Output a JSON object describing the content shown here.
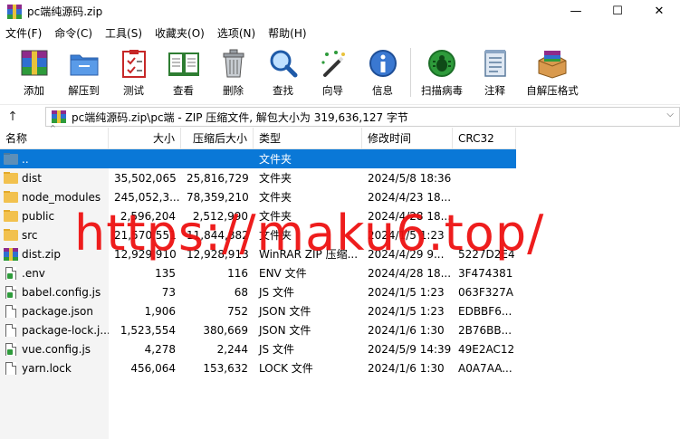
{
  "window": {
    "title": "pc端纯源码.zip",
    "controls": {
      "minimize": "—",
      "maximize": "☐",
      "close": "✕"
    }
  },
  "menu": [
    "文件(F)",
    "命令(C)",
    "工具(S)",
    "收藏夹(O)",
    "选项(N)",
    "帮助(H)"
  ],
  "toolbar": [
    {
      "id": "add",
      "label": "添加",
      "icon": "archive-add-icon"
    },
    {
      "id": "extract",
      "label": "解压到",
      "icon": "folder-extract-icon"
    },
    {
      "id": "test",
      "label": "测试",
      "icon": "clipboard-check-icon"
    },
    {
      "id": "view",
      "label": "查看",
      "icon": "book-icon"
    },
    {
      "id": "delete",
      "label": "删除",
      "icon": "trash-icon"
    },
    {
      "id": "find",
      "label": "查找",
      "icon": "magnifier-icon"
    },
    {
      "id": "wizard",
      "label": "向导",
      "icon": "magic-wand-icon"
    },
    {
      "id": "info",
      "label": "信息",
      "icon": "info-icon"
    },
    {
      "id": "virus",
      "label": "扫描病毒",
      "icon": "bug-scan-icon"
    },
    {
      "id": "comment",
      "label": "注释",
      "icon": "notepad-icon"
    },
    {
      "id": "sfx",
      "label": "自解压格式",
      "icon": "sfx-box-icon"
    }
  ],
  "address": {
    "up_icon": "↑",
    "path": "pc端纯源码.zip\\pc端 - ZIP 压缩文件, 解包大小为 319,636,127 字节",
    "dropdown_icon": "chevron-down-icon"
  },
  "columns": {
    "name": "名称",
    "size": "大小",
    "packed": "压缩后大小",
    "type": "类型",
    "modified": "修改时间",
    "crc": "CRC32",
    "sort_arrow": "^"
  },
  "rows": [
    {
      "icon": "folder-up",
      "name": "..",
      "size": "",
      "packed": "",
      "type": "文件夹",
      "modified": "",
      "crc": "",
      "selected": true
    },
    {
      "icon": "folder",
      "name": "dist",
      "size": "35,502,065",
      "packed": "25,816,729",
      "type": "文件夹",
      "modified": "2024/5/8 18:36",
      "crc": ""
    },
    {
      "icon": "folder",
      "name": "node_modules",
      "size": "245,052,3...",
      "packed": "78,359,210",
      "type": "文件夹",
      "modified": "2024/4/23 18...",
      "crc": ""
    },
    {
      "icon": "folder",
      "name": "public",
      "size": "2,596,204",
      "packed": "2,512,990",
      "type": "文件夹",
      "modified": "2024/4/28 18...",
      "crc": ""
    },
    {
      "icon": "folder",
      "name": "src",
      "size": "21,570,551",
      "packed": "11,844,882",
      "type": "文件夹",
      "modified": "2024/1/5 1:23",
      "crc": ""
    },
    {
      "icon": "rar",
      "name": "dist.zip",
      "size": "12,929,910",
      "packed": "12,928,913",
      "type": "WinRAR ZIP 压缩...",
      "modified": "2024/4/29 9...",
      "crc": "5227D2E4"
    },
    {
      "icon": "doc-green",
      "name": ".env",
      "size": "135",
      "packed": "116",
      "type": "ENV 文件",
      "modified": "2024/4/28 18...",
      "crc": "3F474381"
    },
    {
      "icon": "doc-green",
      "name": "babel.config.js",
      "size": "73",
      "packed": "68",
      "type": "JS 文件",
      "modified": "2024/1/5 1:23",
      "crc": "063F327A"
    },
    {
      "icon": "doc",
      "name": "package.json",
      "size": "1,906",
      "packed": "752",
      "type": "JSON 文件",
      "modified": "2024/1/5 1:23",
      "crc": "EDBBF6..."
    },
    {
      "icon": "doc",
      "name": "package-lock.j...",
      "size": "1,523,554",
      "packed": "380,669",
      "type": "JSON 文件",
      "modified": "2024/1/6 1:30",
      "crc": "2B76BB..."
    },
    {
      "icon": "doc-green",
      "name": "vue.config.js",
      "size": "4,278",
      "packed": "2,244",
      "type": "JS 文件",
      "modified": "2024/5/9 14:39",
      "crc": "49E2AC12"
    },
    {
      "icon": "doc",
      "name": "yarn.lock",
      "size": "456,064",
      "packed": "153,632",
      "type": "LOCK 文件",
      "modified": "2024/1/6 1:30",
      "crc": "A0A7AA..."
    }
  ],
  "watermark": "https://maku6.top/",
  "colors": {
    "selection": "#0a78d7",
    "watermark": "#ee1111",
    "folder": "#f2c14e"
  }
}
